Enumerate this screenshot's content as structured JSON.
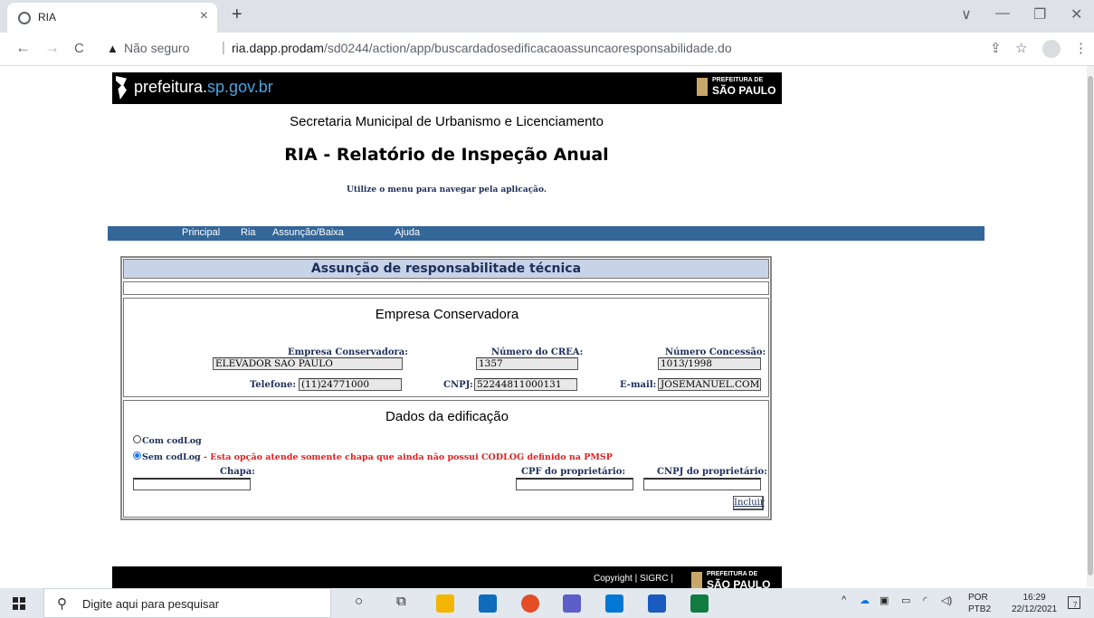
{
  "browser": {
    "tab_title": "RIA",
    "tab_close": "×",
    "new_tab": "+",
    "security_label": "Não seguro",
    "url_host": "ria.dapp.prodam",
    "url_path": "/sd0244/action/app/buscardadosedificacaoassuncaoresponsabilidade.do",
    "window": {
      "minimize": "—",
      "restore": "❐",
      "close": "✕",
      "tab_list": "∨"
    },
    "nav": {
      "back": "←",
      "forward": "→",
      "reload": "C"
    },
    "addr_icons": {
      "share": "⇪",
      "star": "☆",
      "menu": "⋮"
    }
  },
  "banner": {
    "logo_main": "prefeitura.",
    "logo_sp": "sp.gov.br",
    "pref_top": "PREFEITURA DE",
    "pref_bottom": "SÃO PAULO"
  },
  "header": {
    "secretaria": "Secretaria Municipal de Urbanismo e Licenciamento",
    "title": "RIA - Relatório de Inspeção Anual",
    "hint": "Utilize o menu para navegar pela aplicação."
  },
  "nav": {
    "items": [
      "Principal",
      "Ria",
      "Assunção/Baixa",
      "Ajuda"
    ]
  },
  "form": {
    "header": "Assunção de responsabilitade técnica",
    "empresa": {
      "section_title": "Empresa Conservadora",
      "empresa_label": "Empresa Conservadora:",
      "empresa_value": "ELEVADOR SAO PAULO",
      "crea_label": "Número do CREA:",
      "crea_value": "1357",
      "concessao_label": "Número Concessão:",
      "concessao_value": "1013/1998",
      "telefone_label": "Telefone:",
      "telefone_value": "(11)24771000",
      "cnpj_label": "CNPJ:",
      "cnpj_value": "52244811000131",
      "email_label": "E-mail:",
      "email_value": "JOSEMANUEL.COM.B"
    },
    "dados": {
      "section_title": "Dados da edificação",
      "radio_com": "Com codLog",
      "radio_sem": "Sem codLog",
      "radio_sem_warning": " - Esta opção atende somente chapa que ainda não possui CODLOG definido na PMSP",
      "selected": "sem",
      "chapa_label": "Chapa:",
      "cpf_label": "CPF do proprietário:",
      "cnpj_label": "CNPJ do proprietário:",
      "incluir": "Incluir"
    }
  },
  "footer": {
    "copyright": "Copyright | SIGRC |",
    "pref_top": "PREFEITURA DE",
    "pref_bottom": "SÃO PAULO"
  },
  "taskbar": {
    "search_placeholder": "Digite aqui para pesquisar",
    "lang_top": "POR",
    "lang_bottom": "PTB2",
    "time": "16:29",
    "date": "22/12/2021",
    "notif_count": "7",
    "app_colors": [
      "#f2b600",
      "#0f6cbd",
      "#e44d26",
      "#5b5fc7",
      "#0078d4",
      "#185abd",
      "#107c41"
    ]
  }
}
